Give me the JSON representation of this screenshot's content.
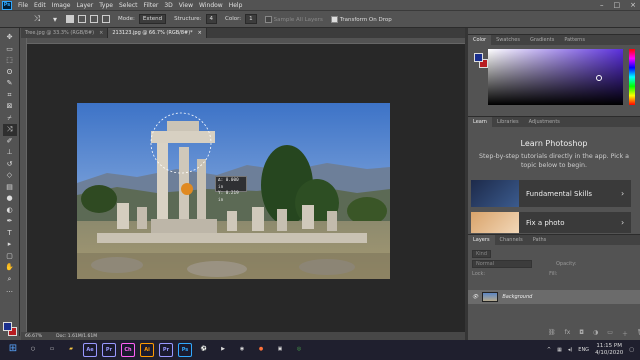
{
  "menubar": {
    "logo": "Ps",
    "items": [
      "File",
      "Edit",
      "Image",
      "Layer",
      "Type",
      "Select",
      "Filter",
      "3D",
      "View",
      "Window",
      "Help"
    ]
  },
  "optbar": {
    "mode_label": "Mode:",
    "mode_value": "Extend",
    "structure_label": "Structure:",
    "structure_value": "4",
    "color_label": "Color:",
    "color_value": "1",
    "sample_all_label": "Sample All Layers",
    "transform_label": "Transform On Drop"
  },
  "tabs": [
    {
      "label": "Tree.jpg @ 33.3% (RGB/8#)",
      "close": "×"
    },
    {
      "label": "213123.jpg @ 66.7% (RGB/8#)*",
      "close": "×"
    }
  ],
  "info_tip": {
    "x": "Δ: 0.000 in",
    "y": "Y: 0.219 in"
  },
  "statusbar": {
    "zoom": "66.67%",
    "doc": "Doc: 1.61M/1.61M"
  },
  "color_panel": {
    "tabs": [
      "Color",
      "Swatches",
      "Gradients",
      "Patterns"
    ]
  },
  "learn_panel": {
    "tabs": [
      "Learn",
      "Libraries",
      "Adjustments"
    ],
    "title": "Learn Photoshop",
    "description": "Step-by-step tutorials directly in the app. Pick a topic below to begin.",
    "cards": [
      {
        "label": "Fundamental Skills",
        "arrow": "›"
      },
      {
        "label": "Fix a photo",
        "arrow": "›"
      }
    ]
  },
  "layers_panel": {
    "tabs": [
      "Layers",
      "Channels",
      "Paths"
    ],
    "kind": "Kind",
    "blend": "Normal",
    "opacity_label": "Opacity:",
    "lock_label": "Lock:",
    "fill_label": "Fill:",
    "layer_name": "Background"
  },
  "taskbar": {
    "apps": [
      {
        "label": "Ae",
        "color": "#9999ff"
      },
      {
        "label": "Pr",
        "color": "#9999ff"
      },
      {
        "label": "Ch",
        "color": "#ff61f6"
      },
      {
        "label": "Ai",
        "color": "#ff9a00"
      },
      {
        "label": "Pr",
        "color": "#9999ff"
      },
      {
        "label": "Ps",
        "color": "#31a8ff"
      }
    ],
    "lang": "ENG",
    "time": "11:15 PM",
    "date": "4/10/2020"
  }
}
